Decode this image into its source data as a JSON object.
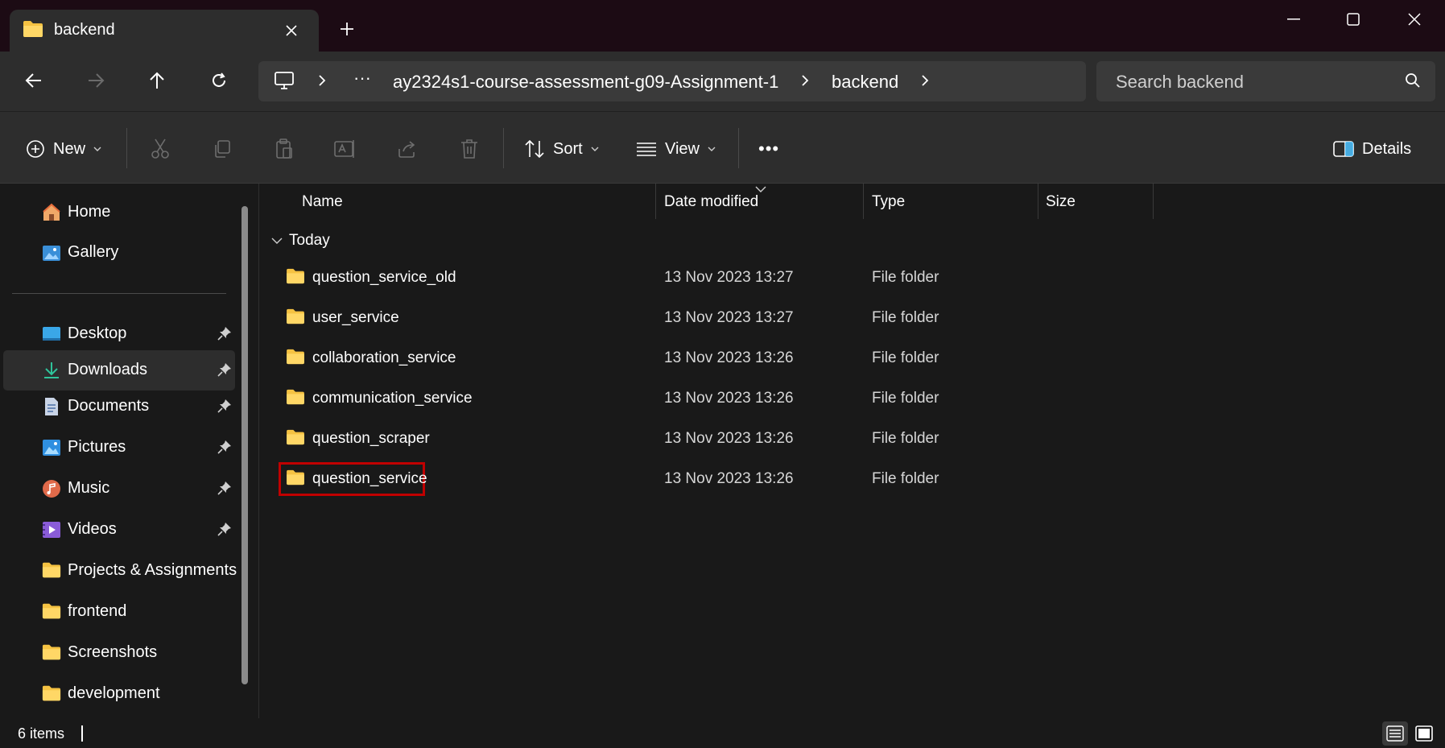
{
  "window": {
    "tab_title": "backend",
    "new_tab_symbol": "+"
  },
  "address": {
    "ellipsis": "···",
    "segments": [
      "ay2324s1-course-assessment-g09-Assignment-1",
      "backend"
    ],
    "search_placeholder": "Search backend"
  },
  "toolbar": {
    "new_label": "New",
    "sort_label": "Sort",
    "view_label": "View",
    "more_symbol": "•••",
    "details_label": "Details"
  },
  "sidebar": {
    "items": [
      {
        "label": "Home",
        "icon": "home-icon"
      },
      {
        "label": "Gallery",
        "icon": "gallery-icon"
      },
      {
        "label": "Desktop",
        "icon": "desktop-icon",
        "pinned": true
      },
      {
        "label": "Downloads",
        "icon": "downloads-icon",
        "pinned": true
      },
      {
        "label": "Documents",
        "icon": "documents-icon",
        "pinned": true
      },
      {
        "label": "Pictures",
        "icon": "pictures-icon",
        "pinned": true
      },
      {
        "label": "Music",
        "icon": "music-icon",
        "pinned": true
      },
      {
        "label": "Videos",
        "icon": "videos-icon",
        "pinned": true
      },
      {
        "label": "Projects & Assignments",
        "icon": "folder-icon"
      },
      {
        "label": "frontend",
        "icon": "folder-icon"
      },
      {
        "label": "Screenshots",
        "icon": "folder-icon"
      },
      {
        "label": "development",
        "icon": "folder-icon"
      }
    ]
  },
  "columns": {
    "name": "Name",
    "date": "Date modified",
    "type": "Type",
    "size": "Size"
  },
  "group": {
    "label": "Today"
  },
  "files": [
    {
      "name": "question_service_old",
      "date": "13 Nov 2023 13:27",
      "type": "File folder"
    },
    {
      "name": "user_service",
      "date": "13 Nov 2023 13:27",
      "type": "File folder"
    },
    {
      "name": "collaboration_service",
      "date": "13 Nov 2023 13:26",
      "type": "File folder"
    },
    {
      "name": "communication_service",
      "date": "13 Nov 2023 13:26",
      "type": "File folder"
    },
    {
      "name": "question_scraper",
      "date": "13 Nov 2023 13:26",
      "type": "File folder"
    },
    {
      "name": "question_service",
      "date": "13 Nov 2023 13:26",
      "type": "File folder"
    }
  ],
  "status": {
    "items_text": "6 items"
  },
  "colors": {
    "folder": "#f5c242",
    "highlight": "#c00000",
    "accent": "#4cc2ff"
  }
}
